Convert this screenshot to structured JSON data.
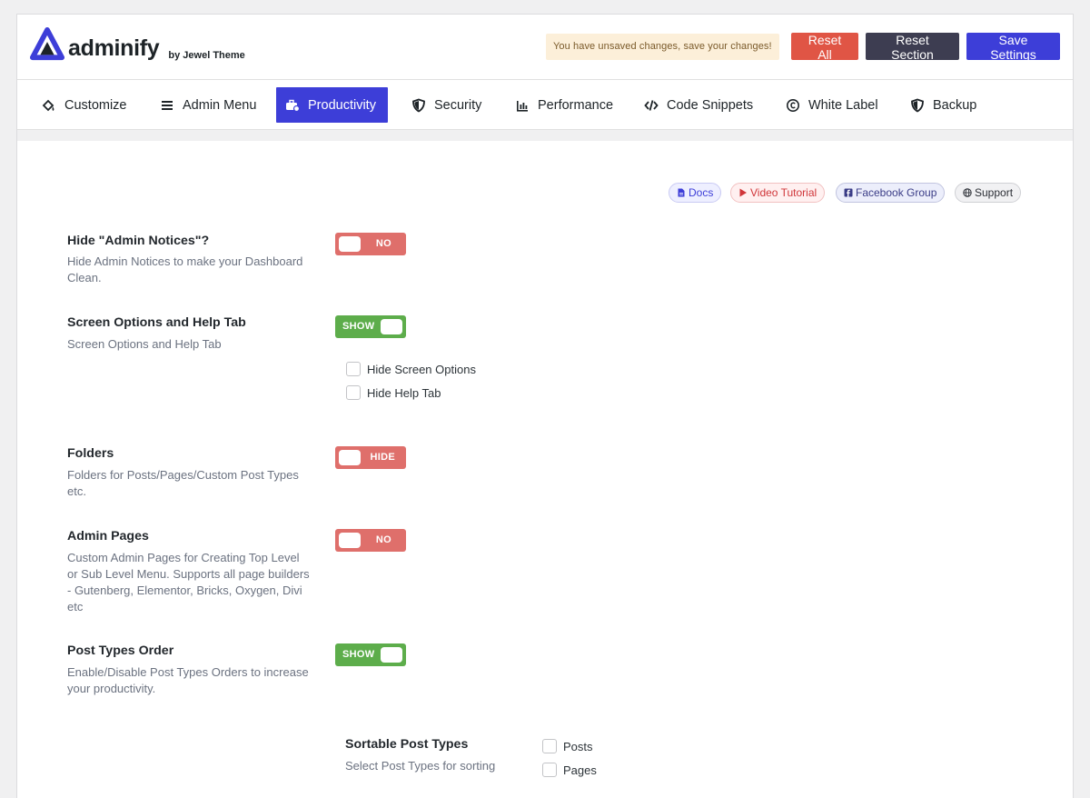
{
  "header": {
    "logo_text": "adminify",
    "logo_by": "by Jewel Theme",
    "unsaved_notice": "You have unsaved changes, save your changes!",
    "reset_all": "Reset All",
    "reset_section": "Reset Section",
    "save_settings": "Save Settings"
  },
  "tabs": [
    {
      "label": "Customize",
      "icon": "paint-bucket-icon",
      "active": false
    },
    {
      "label": "Admin Menu",
      "icon": "hamburger-icon",
      "active": false
    },
    {
      "label": "Productivity",
      "icon": "briefcase-gear-icon",
      "active": true
    },
    {
      "label": "Security",
      "icon": "shield-icon",
      "active": false
    },
    {
      "label": "Performance",
      "icon": "bar-chart-icon",
      "active": false
    },
    {
      "label": "Code Snippets",
      "icon": "code-icon",
      "active": false
    },
    {
      "label": "White Label",
      "icon": "copyright-icon",
      "active": false
    },
    {
      "label": "Backup",
      "icon": "shield-icon",
      "active": false
    }
  ],
  "links": {
    "docs": "Docs",
    "video": "Video Tutorial",
    "facebook": "Facebook Group",
    "support": "Support"
  },
  "settings": {
    "admin_notices": {
      "title": "Hide \"Admin Notices\"?",
      "desc": "Hide Admin Notices to make your Dashboard Clean.",
      "toggle": "NO"
    },
    "screen_options": {
      "title": "Screen Options and Help Tab",
      "desc": "Screen Options and Help Tab",
      "toggle": "SHOW",
      "options": [
        "Hide Screen Options",
        "Hide Help Tab"
      ]
    },
    "folders": {
      "title": "Folders",
      "desc": "Folders for Posts/Pages/Custom Post Types etc.",
      "toggle": "HIDE"
    },
    "admin_pages": {
      "title": "Admin Pages",
      "desc": "Custom Admin Pages for Creating Top Level or Sub Level Menu. Supports all page builders - Gutenberg, Elementor, Bricks, Oxygen, Divi etc",
      "toggle": "NO"
    },
    "post_types_order": {
      "title": "Post Types Order",
      "desc": "Enable/Disable Post Types Orders to increase your productivity.",
      "toggle": "SHOW"
    },
    "sortable": {
      "title": "Sortable Post Types",
      "desc": "Select Post Types for sorting",
      "options": [
        "Posts",
        "Pages"
      ]
    }
  },
  "colors": {
    "accent": "#3d3ed8",
    "danger": "#e05545",
    "dark": "#3d3d51",
    "toggle_off": "#df6f6b",
    "toggle_on": "#5dad4b"
  }
}
